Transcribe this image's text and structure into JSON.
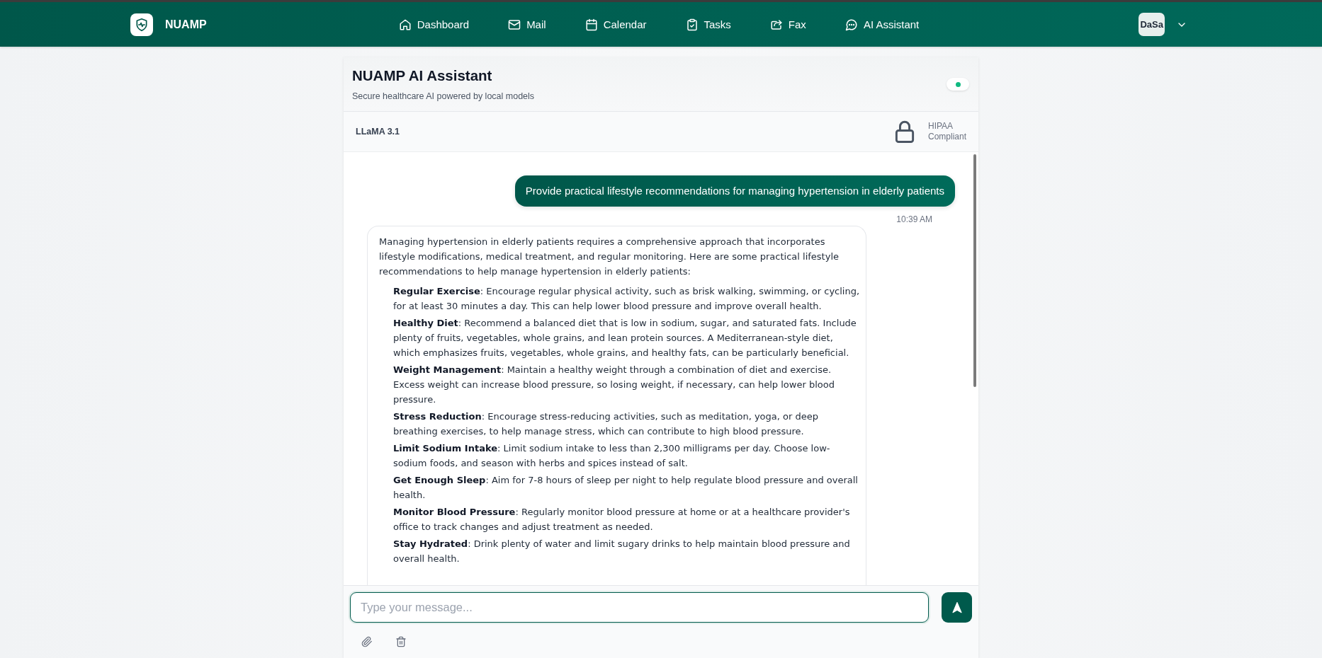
{
  "nav": {
    "brand": "NUAMP",
    "items": [
      {
        "label": "Dashboard",
        "selected": false
      },
      {
        "label": "Mail",
        "selected": false
      },
      {
        "label": "Calendar",
        "selected": false
      },
      {
        "label": "Tasks",
        "selected": false
      },
      {
        "label": "Fax",
        "selected": false
      },
      {
        "label": "AI Assistant",
        "selected": false
      }
    ],
    "avatar": "DaSa"
  },
  "chat": {
    "title": "NUAMP AI Assistant",
    "subtitle": "Secure healthcare AI powered by local models",
    "connected": true,
    "model": "LLaMA 3.1",
    "compliance": "HIPAA Compliant",
    "messages": [
      {
        "kind": "user",
        "text": "Provide practical lifestyle recommendations for managing hypertension in elderly patients",
        "time": "10:39 AM"
      },
      {
        "kind": "assistant",
        "intro": "Managing hypertension in elderly patients requires a comprehensive approach that incorporates lifestyle modifications, medical treatment, and regular monitoring. Here are some practical lifestyle recommendations to help manage hypertension in elderly patients:",
        "items": [
          "**Regular Exercise**: Encourage regular physical activity, such as brisk walking, swimming, or cycling, for at least 30 minutes a day. This can help lower blood pressure and improve overall health.",
          "**Healthy Diet**: Recommend a balanced diet that is low in sodium, sugar, and saturated fats. Include plenty of fruits, vegetables, whole grains, and lean protein sources. A Mediterranean-style diet, which emphasizes fruits, vegetables, whole grains, and healthy fats, can be particularly beneficial.",
          "**Weight Management**: Maintain a healthy weight through a combination of diet and exercise. Excess weight can increase blood pressure, so losing weight, if necessary, can help lower blood pressure.",
          "**Stress Reduction**: Encourage stress-reducing activities, such as meditation, yoga, or deep breathing exercises, to help manage stress, which can contribute to high blood pressure.",
          "**Limit Sodium Intake**: Limit sodium intake to less than 2,300 milligrams per day. Choose low-sodium foods, and season with herbs and spices instead of salt.",
          "**Get Enough Sleep**: Aim for 7-8 hours of sleep per night to help regulate blood pressure and overall health.",
          "**Monitor Blood Pressure**: Regularly monitor blood pressure at home or at a healthcare provider's office to track changes and adjust treatment as needed.",
          "**Stay Hydrated**: Drink plenty of water and limit sugary drinks to help maintain blood pressure and overall health."
        ]
      }
    ],
    "composer": {
      "placeholder": "Type your message..."
    }
  }
}
